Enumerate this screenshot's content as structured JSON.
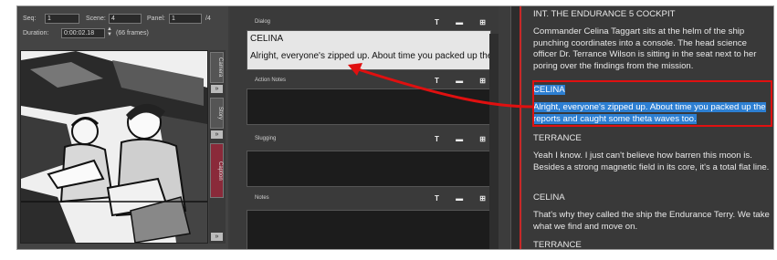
{
  "header": {
    "seq_label": "Seq:",
    "seq_value": "1",
    "scene_label": "Scene:",
    "scene_value": "4",
    "panel_label": "Panel:",
    "panel_value": "1",
    "panel_total": "/4",
    "duration_label": "Duration:",
    "duration_value": "0:00:02.18",
    "frames_text": "(66 frames)"
  },
  "side_tabs": [
    "Camera",
    "Story",
    "Caption"
  ],
  "panels": {
    "dialog": {
      "title": "Dialog",
      "character": "CELINA",
      "line": "Alright, everyone's zipped up. About time you packed up the"
    },
    "action_notes": {
      "title": "Action Notes"
    },
    "slugging": {
      "title": "Slugging"
    },
    "notes": {
      "title": "Notes"
    }
  },
  "script": {
    "scene_heading": "INT. THE ENDURANCE 5 COCKPIT",
    "action": "Commander Celina Taggart sits at the helm of the ship punching coordinates into a console. The head science officer Dr. Terrance Wilson is sitting in the seat next to her poring over the findings from the mission.",
    "character_1": "CELINA",
    "dialog_1": "Alright, everyone's zipped up. About time you packed up the reports and caught some theta waves too.",
    "character_2": "TERRANCE",
    "dialog_2": "Yeah I know. I just can't believe how barren this moon is. Besides a strong magnetic field in its core, it's a total flat line.",
    "character_3": "CELINA",
    "dialog_3": "That's why they called the ship the Endurance Terry. We take what we find and move on.",
    "character_4": "TERRANCE"
  },
  "colors": {
    "highlight": "#2d7fd2",
    "callout": "#e01010"
  }
}
